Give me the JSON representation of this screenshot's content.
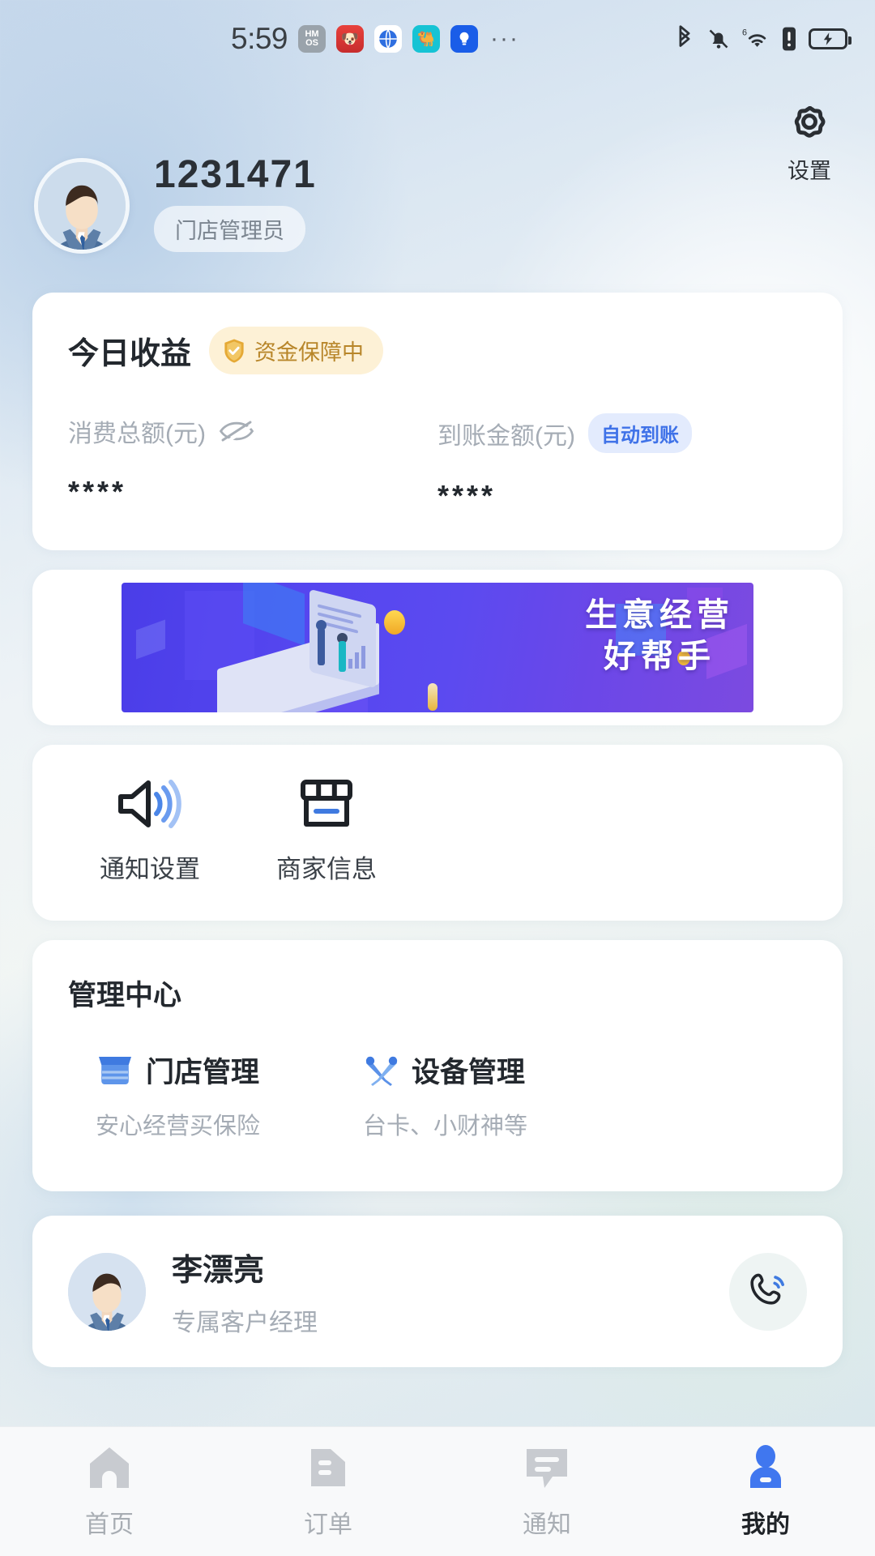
{
  "status_bar": {
    "time": "5:59",
    "app_icons": [
      "hmos-badge-icon",
      "red-app-icon",
      "browser-app-icon",
      "camel-app-icon",
      "lightbulb-app-icon"
    ],
    "hmos_top": "HM",
    "hmos_bottom": "OS",
    "overflow": "···",
    "right_icons": [
      "bluetooth-icon",
      "mute-bell-icon",
      "wifi6-icon",
      "sim-alert-icon",
      "battery-charging-icon"
    ],
    "wifi_generation": "6"
  },
  "header": {
    "settings_label": "设置"
  },
  "profile": {
    "name": "1231471",
    "role": "门店管理员"
  },
  "earnings": {
    "title": "今日收益",
    "guard_badge": "资金保障中",
    "columns": [
      {
        "label": "消费总额(元)",
        "value": "****",
        "has_eye_toggle": true,
        "badge": ""
      },
      {
        "label": "到账金额(元)",
        "value": "****",
        "has_eye_toggle": false,
        "badge": "自动到账"
      }
    ]
  },
  "banner": {
    "line1": "生意经营",
    "line2": "好帮手"
  },
  "quick_actions": [
    {
      "label": "通知设置",
      "icon": "speaker-icon"
    },
    {
      "label": "商家信息",
      "icon": "store-icon"
    }
  ],
  "management": {
    "title": "管理中心",
    "items": [
      {
        "name": "门店管理",
        "desc": "安心经营买保险",
        "icon": "storefront-icon"
      },
      {
        "name": "设备管理",
        "desc": "台卡、小财神等",
        "icon": "tools-icon"
      }
    ]
  },
  "manager": {
    "name": "李漂亮",
    "role": "专属客户经理",
    "call_icon": "phone-call-icon"
  },
  "tabbar": {
    "items": [
      {
        "label": "首页",
        "icon": "home-icon",
        "active": false
      },
      {
        "label": "订单",
        "icon": "order-list-icon",
        "active": false
      },
      {
        "label": "通知",
        "icon": "message-icon",
        "active": false
      },
      {
        "label": "我的",
        "icon": "person-icon",
        "active": true
      }
    ]
  },
  "colors": {
    "accent_blue": "#3f72e8",
    "guard_gold": "#b8862a",
    "guard_bg": "#fdf1d6",
    "auto_bg": "#e3ebfd",
    "text_dark": "#23282e",
    "text_muted": "#a5acb5",
    "card_bg": "#ffffff"
  }
}
